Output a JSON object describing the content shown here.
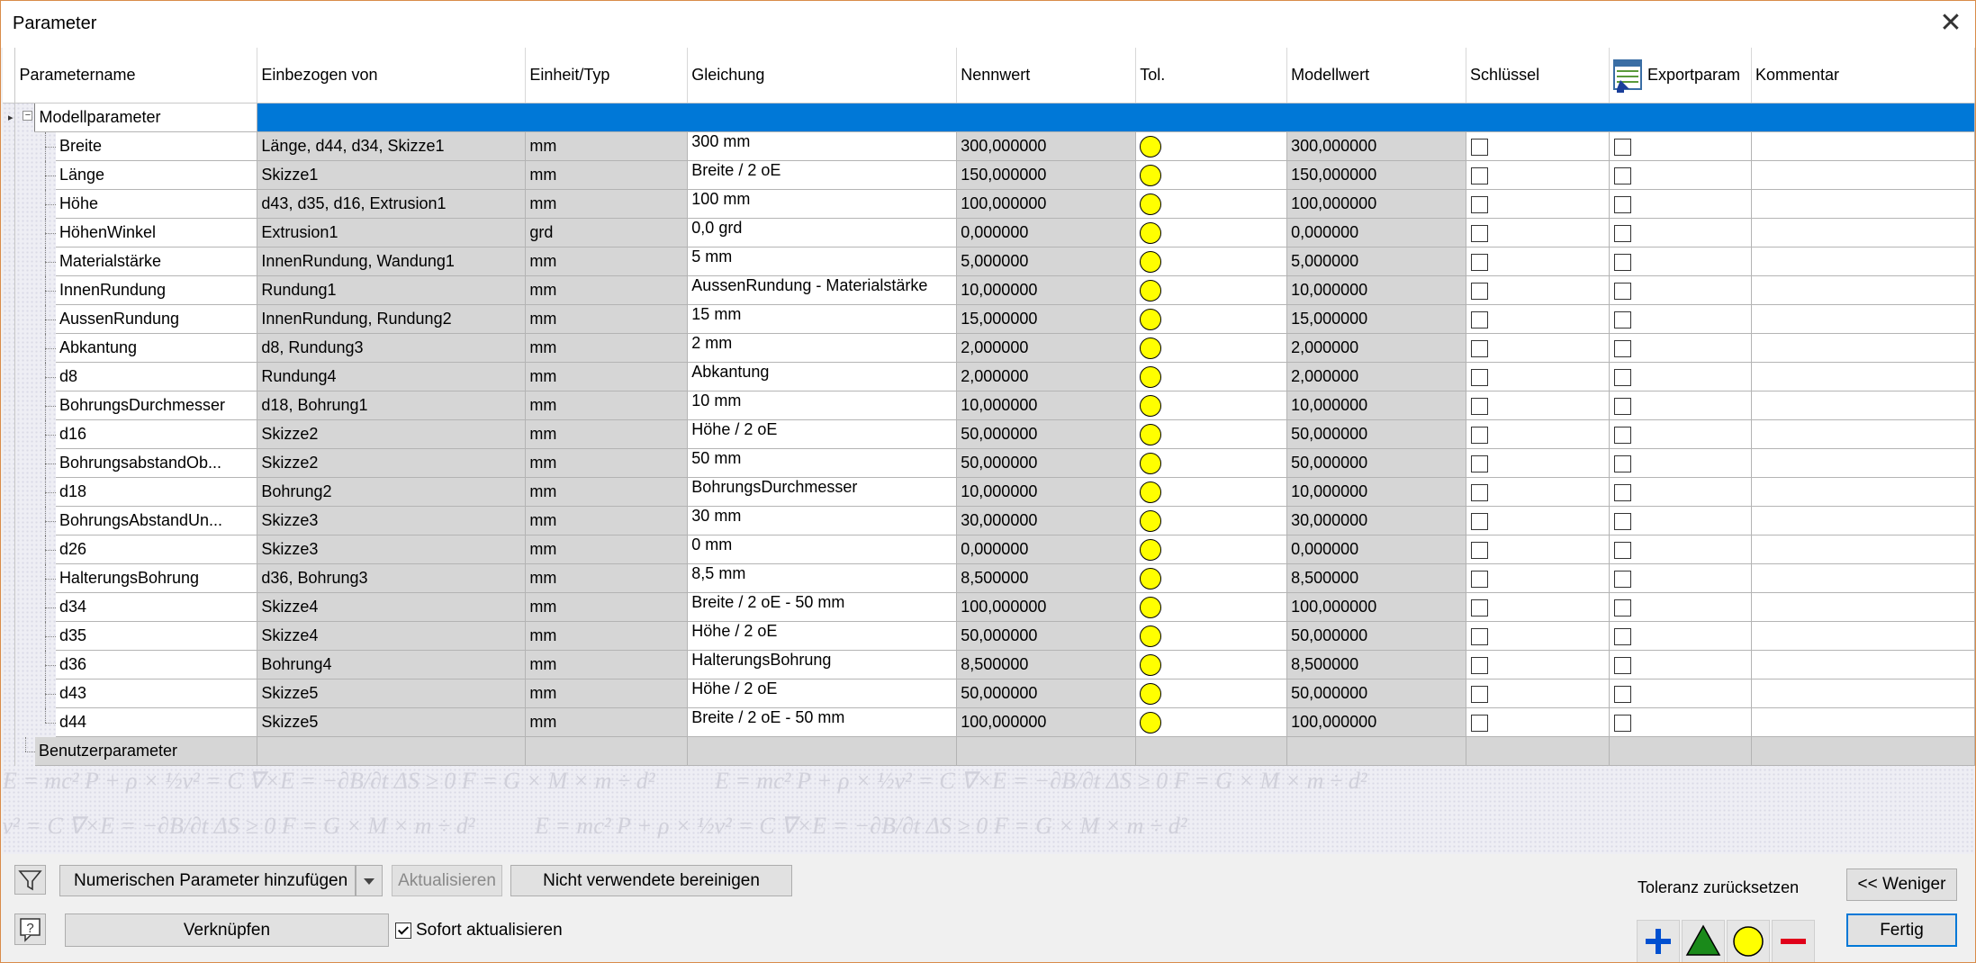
{
  "window": {
    "title": "Parameter",
    "close_glyph": "✕"
  },
  "watermark_text": "E = mc²     P + ρ × ½v² = C     ∇×E = −∂B/∂t     ΔS ≥ 0     F = G × M × m ÷ d²",
  "table": {
    "columns": [
      "Parametername",
      "Einbezogen von",
      "Einheit/Typ",
      "Gleichung",
      "Nennwert",
      "Tol.",
      "Modellwert",
      "Schlüssel",
      "Exportparam",
      "Kommentar"
    ],
    "groups": {
      "model": "Modellparameter",
      "user": "Benutzerparameter"
    },
    "rows": [
      {
        "name": "Breite",
        "used_by": "Länge, d44, d34, Skizze1",
        "unit": "mm",
        "equation": "300 mm",
        "nominal": "300,000000",
        "model": "300,000000"
      },
      {
        "name": "Länge",
        "used_by": "Skizze1",
        "unit": "mm",
        "equation": "Breite / 2 oE",
        "nominal": "150,000000",
        "model": "150,000000"
      },
      {
        "name": "Höhe",
        "used_by": "d43, d35, d16, Extrusion1",
        "unit": "mm",
        "equation": "100 mm",
        "nominal": "100,000000",
        "model": "100,000000"
      },
      {
        "name": "HöhenWinkel",
        "used_by": "Extrusion1",
        "unit": "grd",
        "equation": "0,0 grd",
        "nominal": "0,000000",
        "model": "0,000000"
      },
      {
        "name": "Materialstärke",
        "used_by": "InnenRundung, Wandung1",
        "unit": "mm",
        "equation": "5 mm",
        "nominal": "5,000000",
        "model": "5,000000"
      },
      {
        "name": "InnenRundung",
        "used_by": "Rundung1",
        "unit": "mm",
        "equation": "AussenRundung - Materialstärke",
        "nominal": "10,000000",
        "model": "10,000000"
      },
      {
        "name": "AussenRundung",
        "used_by": "InnenRundung, Rundung2",
        "unit": "mm",
        "equation": "15 mm",
        "nominal": "15,000000",
        "model": "15,000000"
      },
      {
        "name": "Abkantung",
        "used_by": "d8, Rundung3",
        "unit": "mm",
        "equation": "2 mm",
        "nominal": "2,000000",
        "model": "2,000000"
      },
      {
        "name": "d8",
        "used_by": "Rundung4",
        "unit": "mm",
        "equation": "Abkantung",
        "nominal": "2,000000",
        "model": "2,000000"
      },
      {
        "name": "BohrungsDurchmesser",
        "used_by": "d18, Bohrung1",
        "unit": "mm",
        "equation": "10 mm",
        "nominal": "10,000000",
        "model": "10,000000"
      },
      {
        "name": "d16",
        "used_by": "Skizze2",
        "unit": "mm",
        "equation": "Höhe / 2 oE",
        "nominal": "50,000000",
        "model": "50,000000"
      },
      {
        "name": "BohrungsabstandOb...",
        "used_by": "Skizze2",
        "unit": "mm",
        "equation": "50 mm",
        "nominal": "50,000000",
        "model": "50,000000"
      },
      {
        "name": "d18",
        "used_by": "Bohrung2",
        "unit": "mm",
        "equation": "BohrungsDurchmesser",
        "nominal": "10,000000",
        "model": "10,000000"
      },
      {
        "name": "BohrungsAbstandUn...",
        "used_by": "Skizze3",
        "unit": "mm",
        "equation": "30 mm",
        "nominal": "30,000000",
        "model": "30,000000"
      },
      {
        "name": "d26",
        "used_by": "Skizze3",
        "unit": "mm",
        "equation": "0 mm",
        "nominal": "0,000000",
        "model": "0,000000"
      },
      {
        "name": "HalterungsBohrung",
        "used_by": "d36, Bohrung3",
        "unit": "mm",
        "equation": "8,5 mm",
        "nominal": "8,500000",
        "model": "8,500000"
      },
      {
        "name": "d34",
        "used_by": "Skizze4",
        "unit": "mm",
        "equation": "Breite / 2 oE - 50 mm",
        "nominal": "100,000000",
        "model": "100,000000"
      },
      {
        "name": "d35",
        "used_by": "Skizze4",
        "unit": "mm",
        "equation": "Höhe / 2 oE",
        "nominal": "50,000000",
        "model": "50,000000"
      },
      {
        "name": "d36",
        "used_by": "Bohrung4",
        "unit": "mm",
        "equation": "HalterungsBohrung",
        "nominal": "8,500000",
        "model": "8,500000"
      },
      {
        "name": "d43",
        "used_by": "Skizze5",
        "unit": "mm",
        "equation": "Höhe / 2 oE",
        "nominal": "50,000000",
        "model": "50,000000"
      },
      {
        "name": "d44",
        "used_by": "Skizze5",
        "unit": "mm",
        "equation": "Breite / 2 oE - 50 mm",
        "nominal": "100,000000",
        "model": "100,000000"
      }
    ]
  },
  "footer": {
    "add_numeric": "Numerischen Parameter hinzufügen",
    "update": "Aktualisieren",
    "purge_unused": "Nicht verwendete bereinigen",
    "link": "Verknüpfen",
    "immediate_update": "Sofort aktualisieren",
    "tolerance_reset": "Toleranz zurücksetzen",
    "less": "<< Weniger",
    "done": "Fertig"
  },
  "colors": {
    "selection": "#0078d7",
    "tol_dot": "#ffff00",
    "tol_plus": "#0050d0",
    "tol_triangle": "#1a8a1a",
    "tol_minus": "#e0001a"
  }
}
